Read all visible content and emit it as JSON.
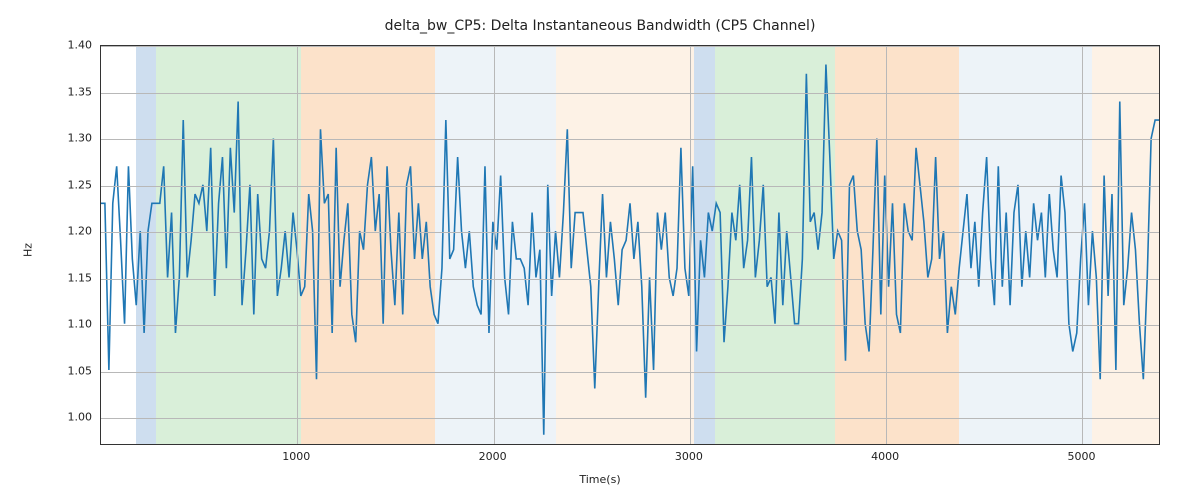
{
  "chart_data": {
    "type": "line",
    "title": "delta_bw_CP5: Delta Instantaneous Bandwidth (CP5 Channel)",
    "xlabel": "Time(s)",
    "ylabel": "Hz",
    "xlim": [
      0,
      5400
    ],
    "ylim": [
      0.97,
      1.4
    ],
    "xticks": [
      1000,
      2000,
      3000,
      4000,
      5000
    ],
    "yticks": [
      1.0,
      1.05,
      1.1,
      1.15,
      1.2,
      1.25,
      1.3,
      1.35,
      1.4
    ],
    "bands": [
      {
        "start": 180,
        "end": 280,
        "color": "#6699cc"
      },
      {
        "start": 280,
        "end": 1020,
        "color": "#88cc88"
      },
      {
        "start": 1020,
        "end": 1700,
        "color": "#f5a65b"
      },
      {
        "start": 1700,
        "end": 2320,
        "color": "#c7d9ea"
      },
      {
        "start": 2320,
        "end": 3020,
        "color": "#f8d6b0"
      },
      {
        "start": 3020,
        "end": 3130,
        "color": "#6699cc"
      },
      {
        "start": 3130,
        "end": 3740,
        "color": "#88cc88"
      },
      {
        "start": 3740,
        "end": 4370,
        "color": "#f5a65b"
      },
      {
        "start": 4370,
        "end": 5050,
        "color": "#c7d9ea"
      },
      {
        "start": 5050,
        "end": 5400,
        "color": "#f8d6b0"
      }
    ],
    "x": [
      0,
      20,
      40,
      60,
      80,
      100,
      120,
      140,
      160,
      180,
      200,
      220,
      240,
      260,
      280,
      300,
      320,
      340,
      360,
      380,
      400,
      420,
      440,
      460,
      480,
      500,
      520,
      540,
      560,
      580,
      600,
      620,
      640,
      660,
      680,
      700,
      720,
      740,
      760,
      780,
      800,
      820,
      840,
      860,
      880,
      900,
      920,
      940,
      960,
      980,
      1000,
      1020,
      1040,
      1060,
      1080,
      1100,
      1120,
      1140,
      1160,
      1180,
      1200,
      1220,
      1240,
      1260,
      1280,
      1300,
      1320,
      1340,
      1360,
      1380,
      1400,
      1420,
      1440,
      1460,
      1480,
      1500,
      1520,
      1540,
      1560,
      1580,
      1600,
      1620,
      1640,
      1660,
      1680,
      1700,
      1720,
      1740,
      1760,
      1780,
      1800,
      1820,
      1840,
      1860,
      1880,
      1900,
      1920,
      1940,
      1960,
      1980,
      2000,
      2020,
      2040,
      2060,
      2080,
      2100,
      2120,
      2140,
      2160,
      2180,
      2200,
      2220,
      2240,
      2260,
      2280,
      2300,
      2320,
      2340,
      2360,
      2380,
      2400,
      2420,
      2440,
      2460,
      2480,
      2500,
      2520,
      2540,
      2560,
      2580,
      2600,
      2620,
      2640,
      2660,
      2680,
      2700,
      2720,
      2740,
      2760,
      2780,
      2800,
      2820,
      2840,
      2860,
      2880,
      2900,
      2920,
      2940,
      2960,
      2980,
      3000,
      3020,
      3040,
      3060,
      3080,
      3100,
      3120,
      3140,
      3160,
      3180,
      3200,
      3220,
      3240,
      3260,
      3280,
      3300,
      3320,
      3340,
      3360,
      3380,
      3400,
      3420,
      3440,
      3460,
      3480,
      3500,
      3520,
      3540,
      3560,
      3580,
      3600,
      3620,
      3640,
      3660,
      3680,
      3700,
      3720,
      3740,
      3760,
      3780,
      3800,
      3820,
      3840,
      3860,
      3880,
      3900,
      3920,
      3940,
      3960,
      3980,
      4000,
      4020,
      4040,
      4060,
      4080,
      4100,
      4120,
      4140,
      4160,
      4180,
      4200,
      4220,
      4240,
      4260,
      4280,
      4300,
      4320,
      4340,
      4360,
      4380,
      4400,
      4420,
      4440,
      4460,
      4480,
      4500,
      4520,
      4540,
      4560,
      4580,
      4600,
      4620,
      4640,
      4660,
      4680,
      4700,
      4720,
      4740,
      4760,
      4780,
      4800,
      4820,
      4840,
      4860,
      4880,
      4900,
      4920,
      4940,
      4960,
      4980,
      5000,
      5020,
      5040,
      5060,
      5080,
      5100,
      5120,
      5140,
      5160,
      5180,
      5200,
      5220,
      5240,
      5260,
      5280,
      5300,
      5320,
      5340,
      5360,
      5380,
      5400
    ],
    "values": [
      1.23,
      1.23,
      1.05,
      1.23,
      1.27,
      1.19,
      1.1,
      1.27,
      1.17,
      1.12,
      1.2,
      1.09,
      1.2,
      1.23,
      1.23,
      1.23,
      1.27,
      1.15,
      1.22,
      1.09,
      1.15,
      1.32,
      1.15,
      1.19,
      1.24,
      1.23,
      1.25,
      1.2,
      1.29,
      1.13,
      1.23,
      1.28,
      1.16,
      1.29,
      1.22,
      1.34,
      1.12,
      1.18,
      1.25,
      1.11,
      1.24,
      1.17,
      1.16,
      1.2,
      1.3,
      1.13,
      1.16,
      1.2,
      1.15,
      1.22,
      1.18,
      1.13,
      1.14,
      1.24,
      1.2,
      1.04,
      1.31,
      1.23,
      1.24,
      1.09,
      1.29,
      1.14,
      1.19,
      1.23,
      1.11,
      1.08,
      1.2,
      1.18,
      1.25,
      1.28,
      1.2,
      1.24,
      1.1,
      1.27,
      1.18,
      1.12,
      1.22,
      1.11,
      1.25,
      1.27,
      1.17,
      1.23,
      1.17,
      1.21,
      1.14,
      1.11,
      1.1,
      1.16,
      1.32,
      1.17,
      1.18,
      1.28,
      1.2,
      1.16,
      1.2,
      1.14,
      1.12,
      1.11,
      1.27,
      1.09,
      1.21,
      1.18,
      1.26,
      1.15,
      1.11,
      1.21,
      1.17,
      1.17,
      1.16,
      1.12,
      1.22,
      1.15,
      1.18,
      0.98,
      1.25,
      1.13,
      1.2,
      1.15,
      1.22,
      1.31,
      1.16,
      1.22,
      1.22,
      1.22,
      1.18,
      1.14,
      1.03,
      1.14,
      1.24,
      1.15,
      1.21,
      1.17,
      1.12,
      1.18,
      1.19,
      1.23,
      1.17,
      1.21,
      1.14,
      1.02,
      1.15,
      1.05,
      1.22,
      1.18,
      1.22,
      1.15,
      1.13,
      1.16,
      1.29,
      1.16,
      1.13,
      1.27,
      1.07,
      1.19,
      1.15,
      1.22,
      1.2,
      1.23,
      1.22,
      1.08,
      1.14,
      1.22,
      1.19,
      1.25,
      1.16,
      1.19,
      1.28,
      1.15,
      1.19,
      1.25,
      1.14,
      1.15,
      1.1,
      1.22,
      1.12,
      1.2,
      1.15,
      1.1,
      1.1,
      1.17,
      1.37,
      1.21,
      1.22,
      1.18,
      1.22,
      1.38,
      1.28,
      1.17,
      1.2,
      1.19,
      1.06,
      1.25,
      1.26,
      1.2,
      1.18,
      1.1,
      1.07,
      1.18,
      1.3,
      1.11,
      1.26,
      1.14,
      1.23,
      1.11,
      1.09,
      1.23,
      1.2,
      1.19,
      1.29,
      1.25,
      1.21,
      1.15,
      1.17,
      1.28,
      1.17,
      1.2,
      1.09,
      1.14,
      1.11,
      1.16,
      1.2,
      1.24,
      1.16,
      1.21,
      1.14,
      1.22,
      1.28,
      1.17,
      1.12,
      1.27,
      1.14,
      1.22,
      1.12,
      1.22,
      1.25,
      1.14,
      1.2,
      1.15,
      1.23,
      1.19,
      1.22,
      1.15,
      1.24,
      1.18,
      1.15,
      1.26,
      1.22,
      1.1,
      1.07,
      1.09,
      1.17,
      1.23,
      1.12,
      1.2,
      1.15,
      1.04,
      1.26,
      1.13,
      1.24,
      1.05,
      1.34,
      1.12,
      1.16,
      1.22,
      1.18,
      1.1,
      1.04,
      1.15,
      1.3,
      1.32,
      1.32
    ]
  }
}
